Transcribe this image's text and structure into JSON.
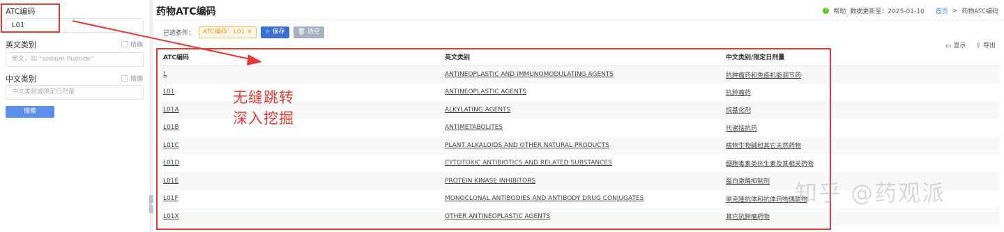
{
  "sidebar": {
    "atc_label": "ATC编码",
    "atc_value": "L01",
    "en_label": "英文类别",
    "en_exact": "精确",
    "en_placeholder": "英文，如 \"sodium fluoride\"",
    "cn_label": "中文类别",
    "cn_exact": "精确",
    "cn_placeholder": "中文类别或限定日剂量",
    "search_label": "搜索"
  },
  "header": {
    "title": "药物ATC编码",
    "help": "帮助",
    "updated": "数据更新至：2025-01-10",
    "crumb_home": "首页",
    "crumb_sep": ">",
    "crumb_current": "药物ATC编码"
  },
  "conditions": {
    "label": "已选条件：",
    "tag": "ATC编码：L01",
    "tag_close": "×",
    "save_icon": "star-icon",
    "save": "保存",
    "clear_icon": "trash-icon",
    "clear": "清空"
  },
  "tools": {
    "show": "显示",
    "export": "导出"
  },
  "table": {
    "headers": [
      "ATC编码",
      "英文类别",
      "中文类别/限定日剂量"
    ],
    "rows": [
      [
        "L",
        "ANTINEOPLASTIC AND IMMUNOMODULATING AGENTS",
        "抗肿瘤药和免疫机能调节药"
      ],
      [
        "L01",
        "ANTINEOPLASTIC AGENTS",
        "抗肿瘤药"
      ],
      [
        "L01A",
        "ALKYLATING AGENTS",
        "烷基化剂"
      ],
      [
        "L01B",
        "ANTIMETABOLITES",
        "代谢拮抗药"
      ],
      [
        "L01C",
        "PLANT ALKALOIDS AND OTHER NATURAL PRODUCTS",
        "植物生物碱和其它天然药物"
      ],
      [
        "L01D",
        "CYTOTOXIC ANTIBIOTICS AND RELATED SUBSTANCES",
        "细胞毒素类抗生素及其相关药物"
      ],
      [
        "L01E",
        "PROTEIN KINASE INHIBITORS",
        "蛋白激酶抑制剂"
      ],
      [
        "L01F",
        "MONOCLONAL ANTIBODIES AND ANTIBODY DRUG CONJUGATES",
        "单克隆抗体和抗体药物偶联物"
      ],
      [
        "L01X",
        "OTHER ANTINEOPLASTIC AGENTS",
        "其它抗肿瘤药物"
      ]
    ]
  },
  "annotations": {
    "line1": "无缝跳转",
    "line2": "深入挖掘",
    "color": "#e53935"
  },
  "watermark": "知乎 @药观派"
}
